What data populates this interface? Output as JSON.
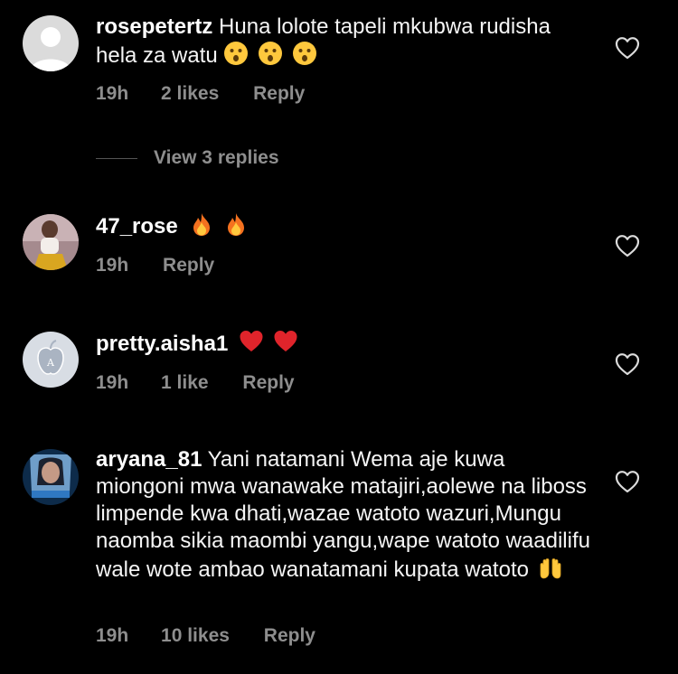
{
  "comments": [
    {
      "username": "rosepetertz",
      "text": "Huna lolote tapeli mkubwa rudisha hela za watu",
      "emojis": [
        "surprised-face",
        "surprised-face",
        "surprised-face"
      ],
      "time": "19h",
      "likes": "2 likes",
      "reply": "Reply"
    },
    {
      "username": "47_rose",
      "text": "",
      "emojis": [
        "fire",
        "fire"
      ],
      "time": "19h",
      "likes": "",
      "reply": "Reply"
    },
    {
      "username": "pretty.aisha1",
      "text": "",
      "emojis": [
        "red-heart",
        "red-heart"
      ],
      "time": "19h",
      "likes": "1 like",
      "reply": "Reply"
    },
    {
      "username": "aryana_81",
      "text": "Yani natamani Wema aje kuwa miongoni mwa wanawake matajiri,aolewe na liboss limpende kwa dhati,wazae watoto wazuri,Mungu naomba sikia maombi yangu,wape watoto waadilifu wale wote ambao wanatamani kupata watoto",
      "emojis": [
        "raised-hands"
      ],
      "time": "19h",
      "likes": "10 likes",
      "reply": "Reply"
    }
  ],
  "view_replies": "View 3 replies",
  "colors": {
    "background": "#000000",
    "text": "#ffffff",
    "muted": "#8e8e8e"
  }
}
